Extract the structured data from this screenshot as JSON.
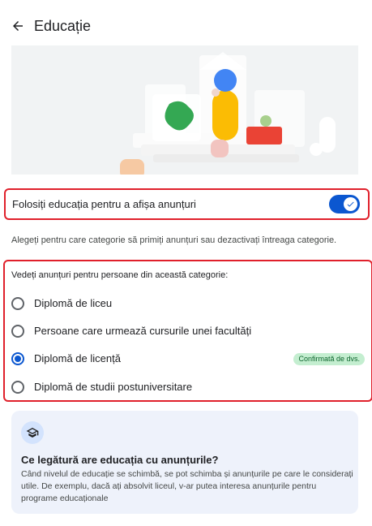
{
  "header": {
    "title": "Educație",
    "back_icon": "arrow-back-icon"
  },
  "hero": {
    "icon": "education-illustration"
  },
  "toggle": {
    "label": "Folosiți educația pentru a afișa anunțuri",
    "enabled": true,
    "accent": "#0b57d0"
  },
  "helper_text": "Alegeți pentru care categorie să primiți anunțuri sau dezactivați întreaga categorie.",
  "categories": {
    "heading": "Vedeți anunțuri pentru persoane din această categorie:",
    "options": [
      {
        "label": "Diplomă de liceu",
        "selected": false
      },
      {
        "label": "Persoane care urmează cursurile unei facultăți",
        "selected": false
      },
      {
        "label": "Diplomă de licență",
        "selected": true,
        "badge": "Confirmată de dvs."
      },
      {
        "label": "Diplomă de studii postuniversitare",
        "selected": false
      }
    ]
  },
  "info_card": {
    "icon": "graduation-cap-icon",
    "title": "Ce legătură are educația cu anunțurile?",
    "body": "Când nivelul de educație se schimbă, se pot schimba și anunțurile pe care le considerați utile. De exemplu, dacă ați absolvit liceul, v-ar putea interesa anunțurile pentru programe educaționale"
  },
  "colors": {
    "highlight_border": "#e0202b",
    "badge_bg": "#c4eed0",
    "badge_text": "#0d652d",
    "card_bg": "#eef2fb"
  }
}
